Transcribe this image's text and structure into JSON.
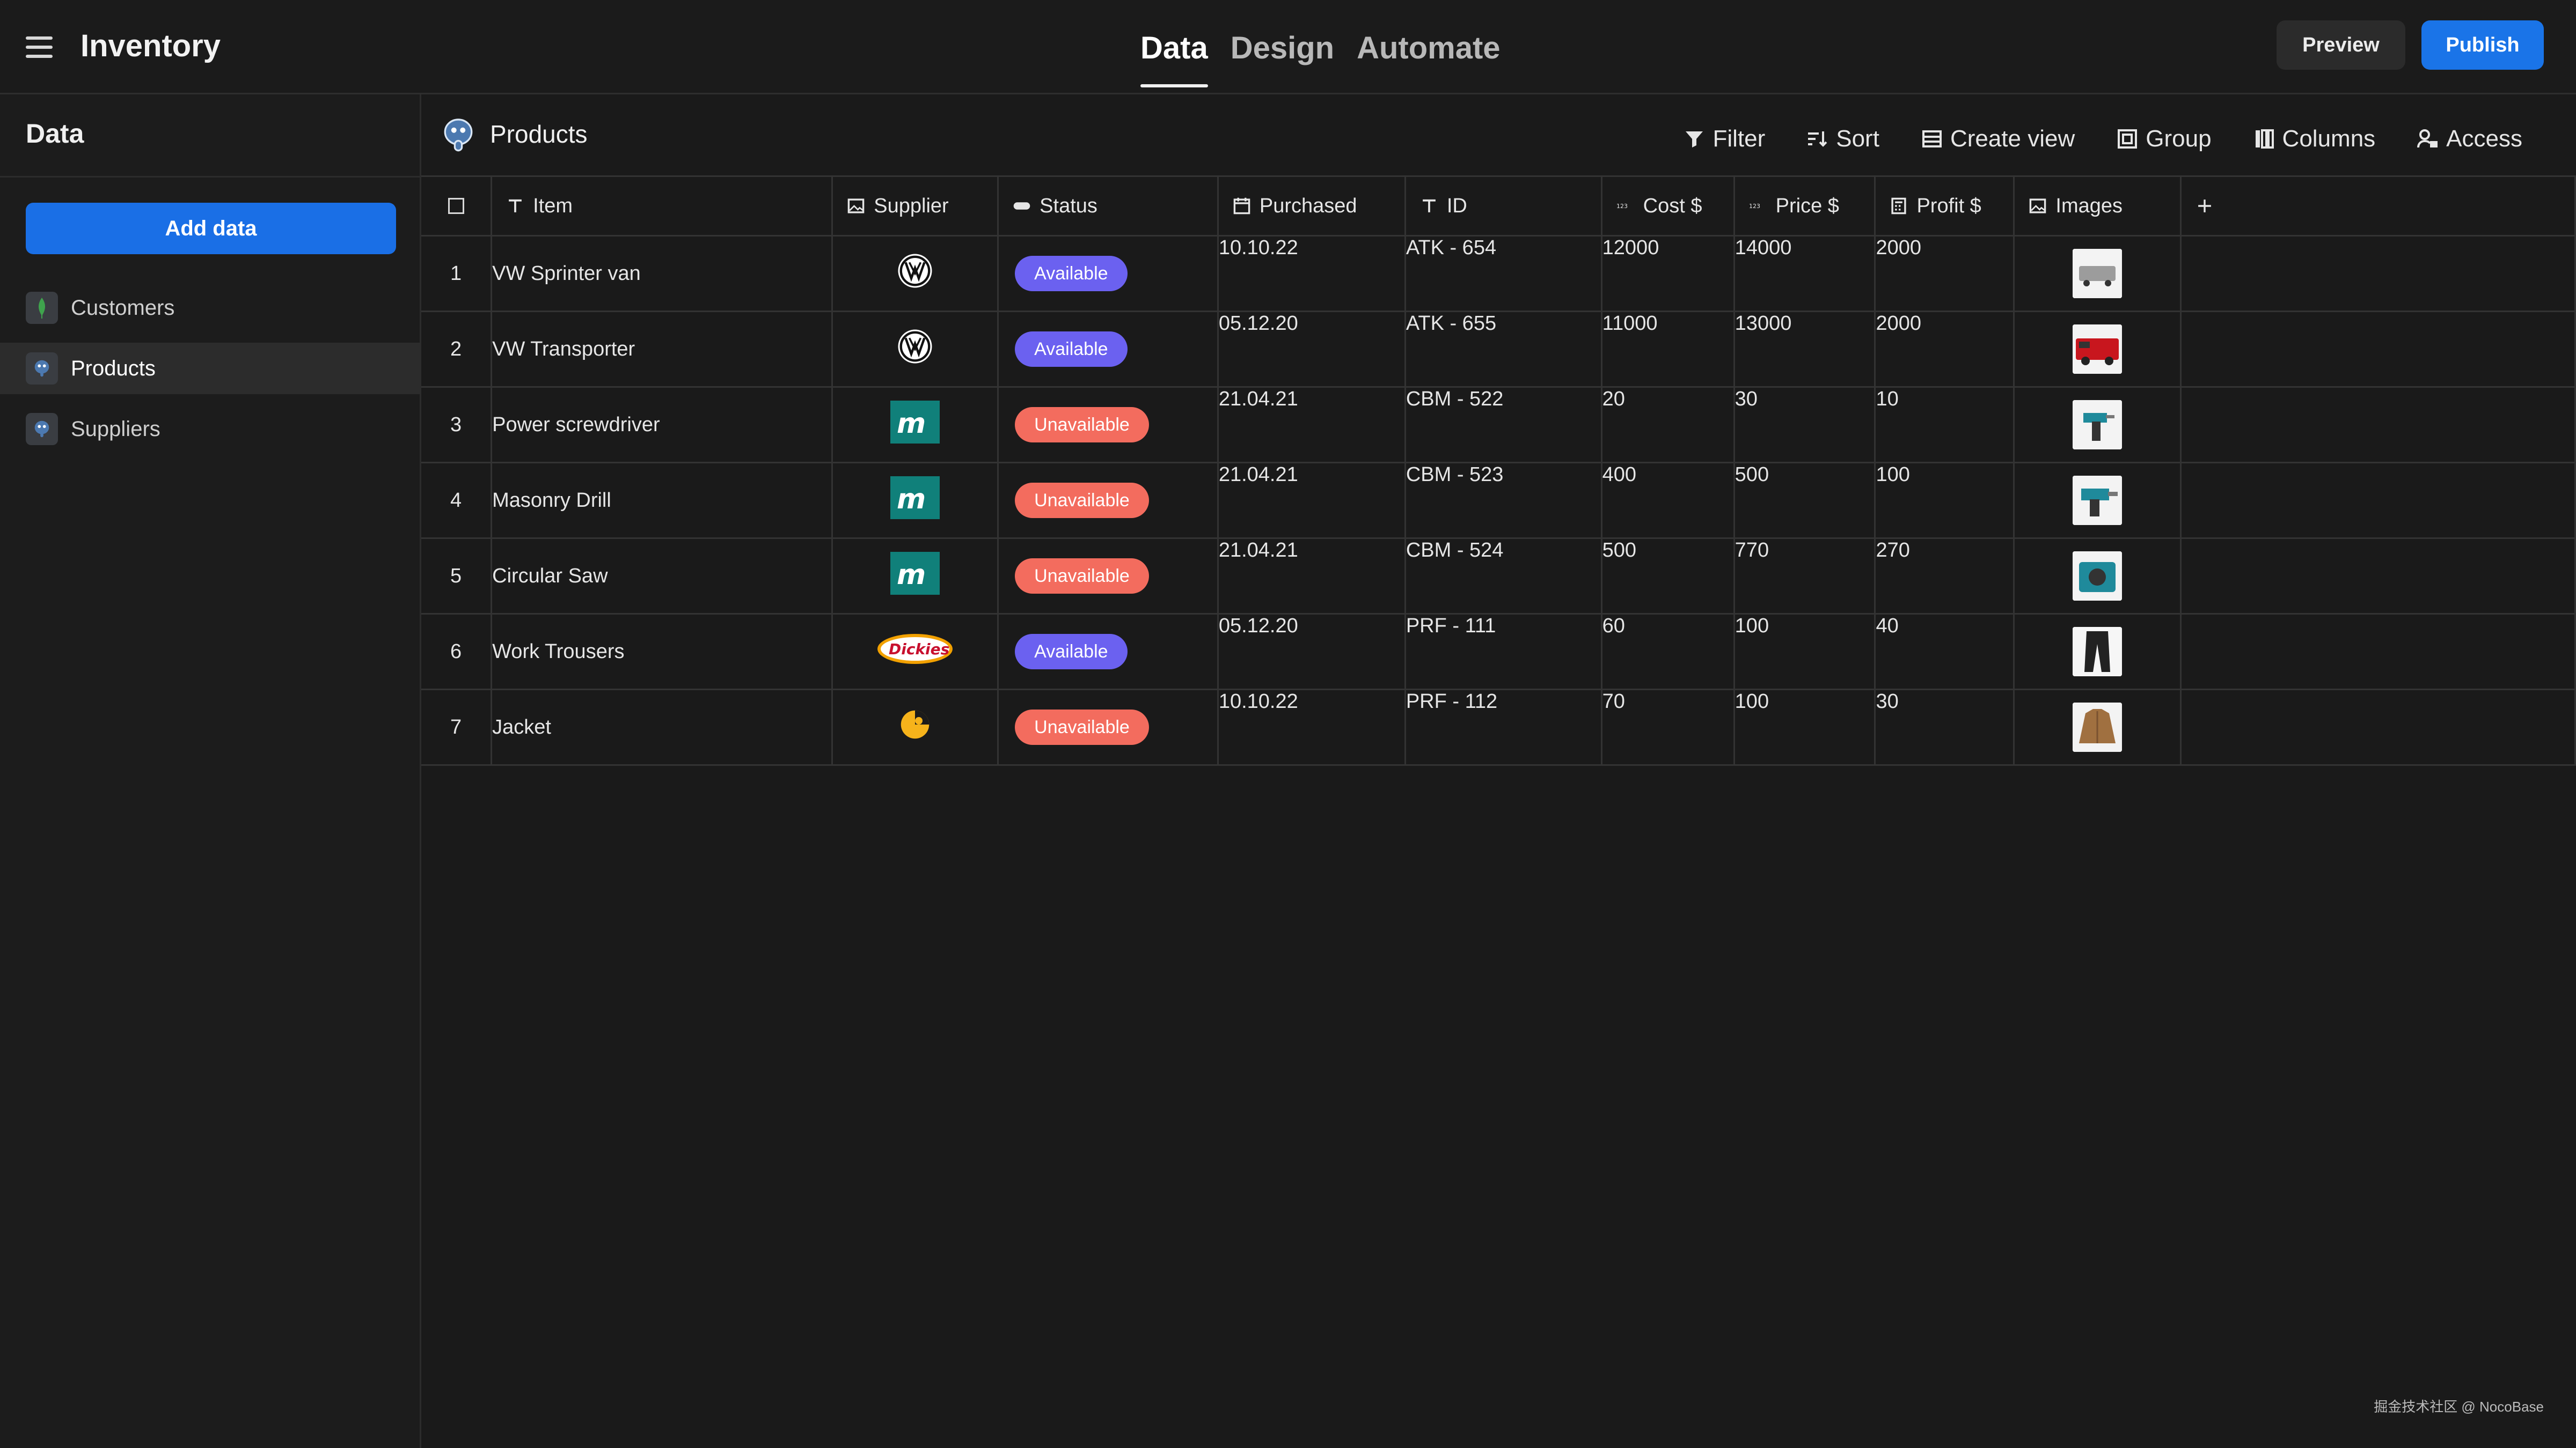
{
  "app": {
    "title": "Inventory"
  },
  "main_tabs": [
    "Data",
    "Design",
    "Automate"
  ],
  "actions": {
    "preview": "Preview",
    "publish": "Publish"
  },
  "sidebar": {
    "header": "Data",
    "add_button": "Add data",
    "items": [
      {
        "label": "Customers",
        "icon": "mongodb-icon"
      },
      {
        "label": "Products",
        "icon": "postgres-icon",
        "active": true
      },
      {
        "label": "Suppliers",
        "icon": "postgres-icon"
      }
    ]
  },
  "table_name": "Products",
  "toolbar": [
    "Filter",
    "Sort",
    "Create view",
    "Group",
    "Columns",
    "Access"
  ],
  "columns": [
    "Item",
    "Supplier",
    "Status",
    "Purchased",
    "ID",
    "Cost $",
    "Price $",
    "Profit $",
    "Images"
  ],
  "rows": [
    {
      "n": "1",
      "item": "VW Sprinter van",
      "supplier": "vw-logo",
      "status": "Available",
      "purchased": "10.10.22",
      "id": "ATK - 654",
      "cost": "12000",
      "price": "14000",
      "profit": "2000",
      "image": "van-image"
    },
    {
      "n": "2",
      "item": "VW Transporter",
      "supplier": "vw-logo",
      "status": "Available",
      "purchased": "05.12.20",
      "id": "ATK - 655",
      "cost": "11000",
      "price": "13000",
      "profit": "2000",
      "image": "red-van-image"
    },
    {
      "n": "3",
      "item": "Power screwdriver",
      "supplier": "makita-logo",
      "status": "Unavailable",
      "purchased": "21.04.21",
      "id": "CBM - 522",
      "cost": "20",
      "price": "30",
      "profit": "10",
      "image": "screwdriver-image"
    },
    {
      "n": "4",
      "item": "Masonry Drill",
      "supplier": "makita-logo",
      "status": "Unavailable",
      "purchased": "21.04.21",
      "id": "CBM - 523",
      "cost": "400",
      "price": "500",
      "profit": "100",
      "image": "drill-image"
    },
    {
      "n": "5",
      "item": "Circular Saw",
      "supplier": "makita-logo",
      "status": "Unavailable",
      "purchased": "21.04.21",
      "id": "CBM - 524",
      "cost": "500",
      "price": "770",
      "profit": "270",
      "image": "saw-image"
    },
    {
      "n": "6",
      "item": "Work Trousers",
      "supplier": "dickies-logo",
      "status": "Available",
      "purchased": "05.12.20",
      "id": "PRF - 111",
      "cost": "60",
      "price": "100",
      "profit": "40",
      "image": "trousers-image"
    },
    {
      "n": "7",
      "item": "Jacket",
      "supplier": "carhartt-logo",
      "status": "Unavailable",
      "purchased": "10.10.22",
      "id": "PRF - 112",
      "cost": "70",
      "price": "100",
      "profit": "30",
      "image": "jacket-image"
    }
  ],
  "colors": {
    "available": "#6b61f0",
    "unavailable": "#f36c5e",
    "accent": "#1a74e8"
  },
  "watermark": "掘金技术社区 @ NocoBase"
}
